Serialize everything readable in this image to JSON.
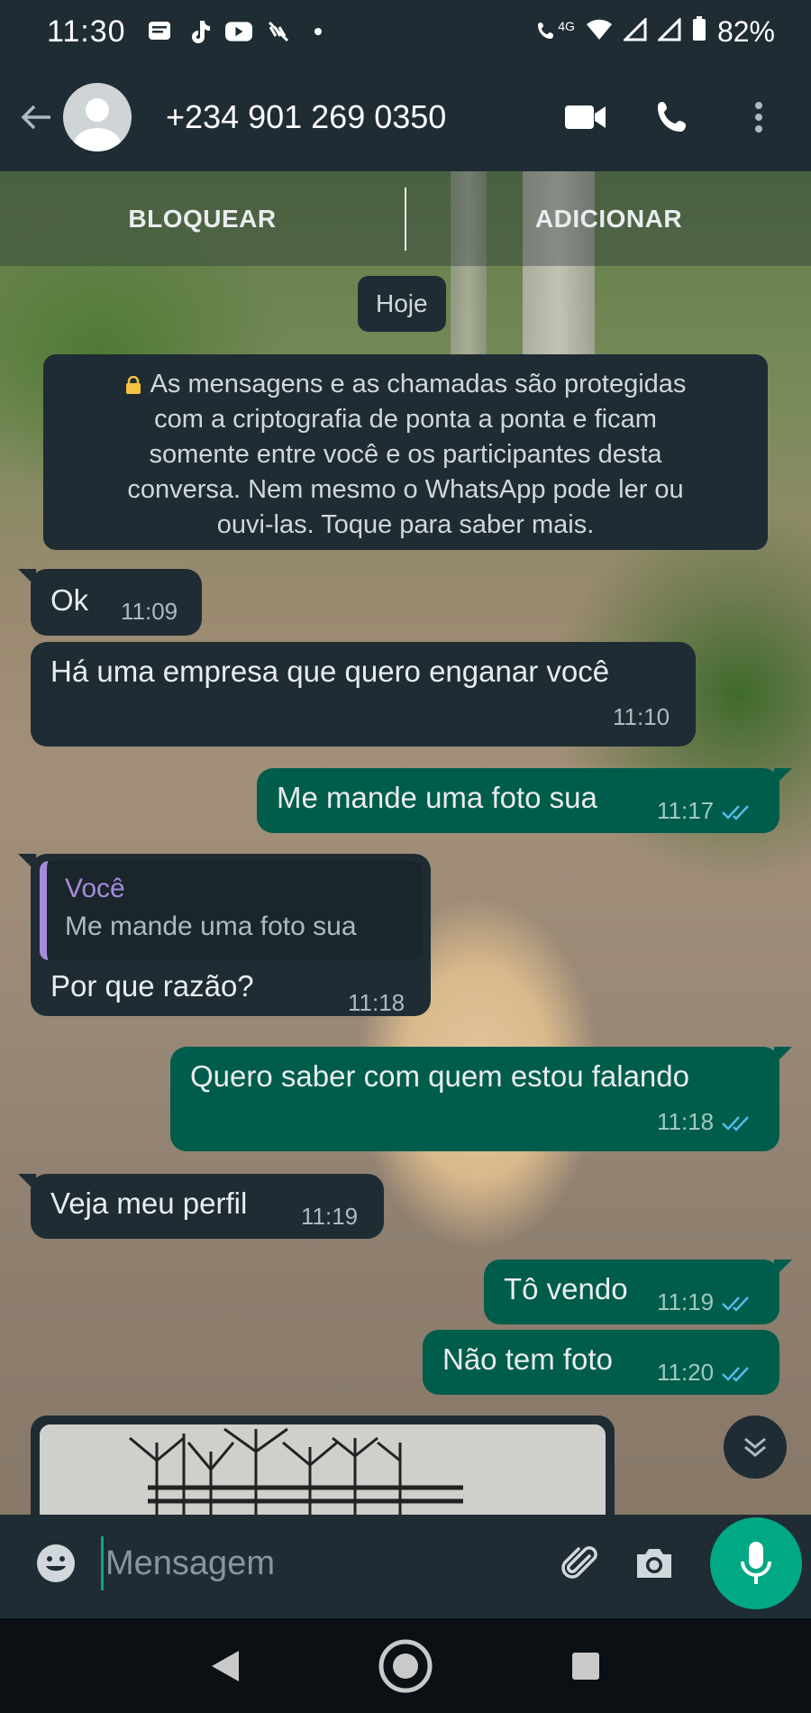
{
  "status_bar": {
    "time": "11:30",
    "network": "4G",
    "battery": "82%"
  },
  "header": {
    "contact": "+234 901 269 0350",
    "icons": [
      "back-arrow-icon",
      "avatar",
      "video-call-icon",
      "voice-call-icon",
      "more-options-icon"
    ]
  },
  "banner": {
    "block_label": "BLOQUEAR",
    "add_label": "ADICIONAR"
  },
  "date_chip": "Hoje",
  "notice": {
    "line1": "As mensagens e as chamadas são protegidas",
    "line2": "com a criptografia de ponta a ponta e ficam",
    "line3": "somente entre você e os participantes desta",
    "line4": "conversa. Nem mesmo o WhatsApp pode ler ou",
    "line5": "ouvi-las. Toque para saber mais."
  },
  "messages": [
    {
      "direction": "in",
      "text": "Ok",
      "time": "11:09"
    },
    {
      "direction": "in",
      "text": "Há uma empresa que quero enganar você",
      "time": "11:10"
    },
    {
      "direction": "out",
      "text": "Me mande uma foto sua",
      "time": "11:17",
      "status": "read"
    },
    {
      "direction": "in",
      "reply_to_name": "Você",
      "reply_to_text": "Me mande uma foto sua",
      "text": "Por que razão?",
      "time": "11:18"
    },
    {
      "direction": "out",
      "text": "Quero saber com quem estou falando",
      "time": "11:18",
      "status": "read"
    },
    {
      "direction": "in",
      "text": "Veja meu perfil",
      "time": "11:19"
    },
    {
      "direction": "out",
      "text": "Tô vendo",
      "time": "11:19",
      "status": "read"
    },
    {
      "direction": "out",
      "text": "Não tem foto",
      "time": "11:20",
      "status": "read"
    }
  ],
  "composer": {
    "placeholder": "Mensagem"
  },
  "colors": {
    "header_bg": "#1f2c34",
    "incoming_bubble": "#1f2c34",
    "outgoing_bubble": "#005c4b",
    "accent": "#00a884",
    "read_tick": "#53bdeb",
    "quote_accent": "#a68bdb"
  }
}
